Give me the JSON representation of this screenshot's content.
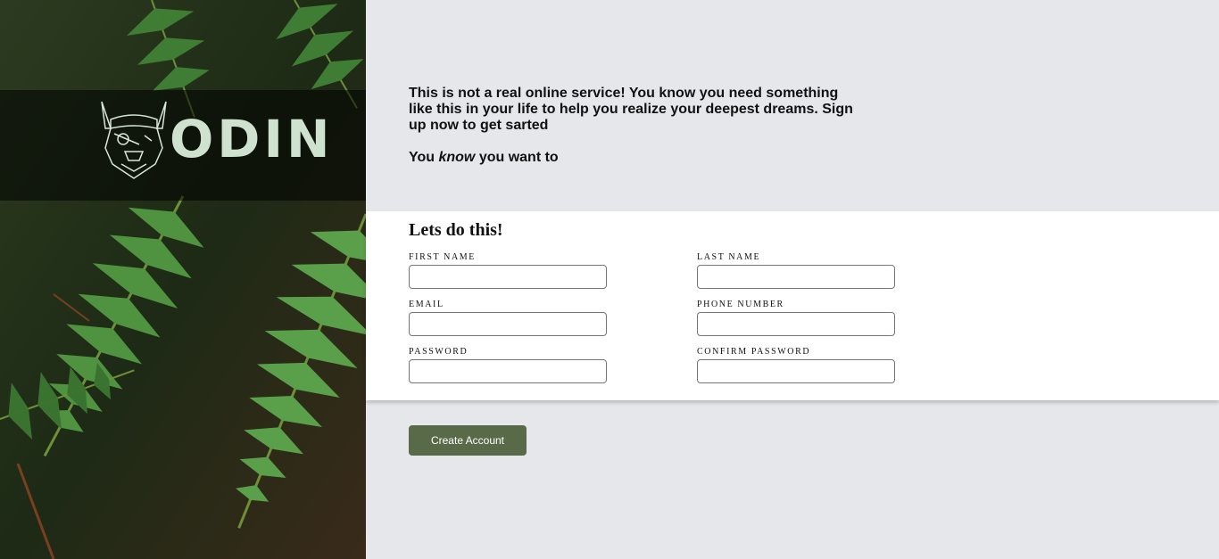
{
  "brand": {
    "logo_text": "ODIN",
    "logo_icon": "viking-bulldog-icon"
  },
  "intro": {
    "line1": "This is not a real online service! You know you need something like this in your life to help you realize your deepest dreams. Sign up now to get sarted",
    "line2_prefix": "You ",
    "line2_emphasis": "know",
    "line2_suffix": " you want to"
  },
  "form": {
    "title": "Lets do this!",
    "fields": {
      "first_name": {
        "label": "FIRST NAME",
        "value": ""
      },
      "last_name": {
        "label": "LAST NAME",
        "value": ""
      },
      "email": {
        "label": "EMAIL",
        "value": ""
      },
      "phone": {
        "label": "PHONE NUMBER",
        "value": ""
      },
      "password": {
        "label": "PASSWORD",
        "value": ""
      },
      "confirm_password": {
        "label": "CONFIRM PASSWORD",
        "value": ""
      }
    },
    "submit_label": "Create Account"
  },
  "colors": {
    "background": "#e5e7eb",
    "panel": "#ffffff",
    "button": "#596a48",
    "logo": "#cfe2cf"
  }
}
